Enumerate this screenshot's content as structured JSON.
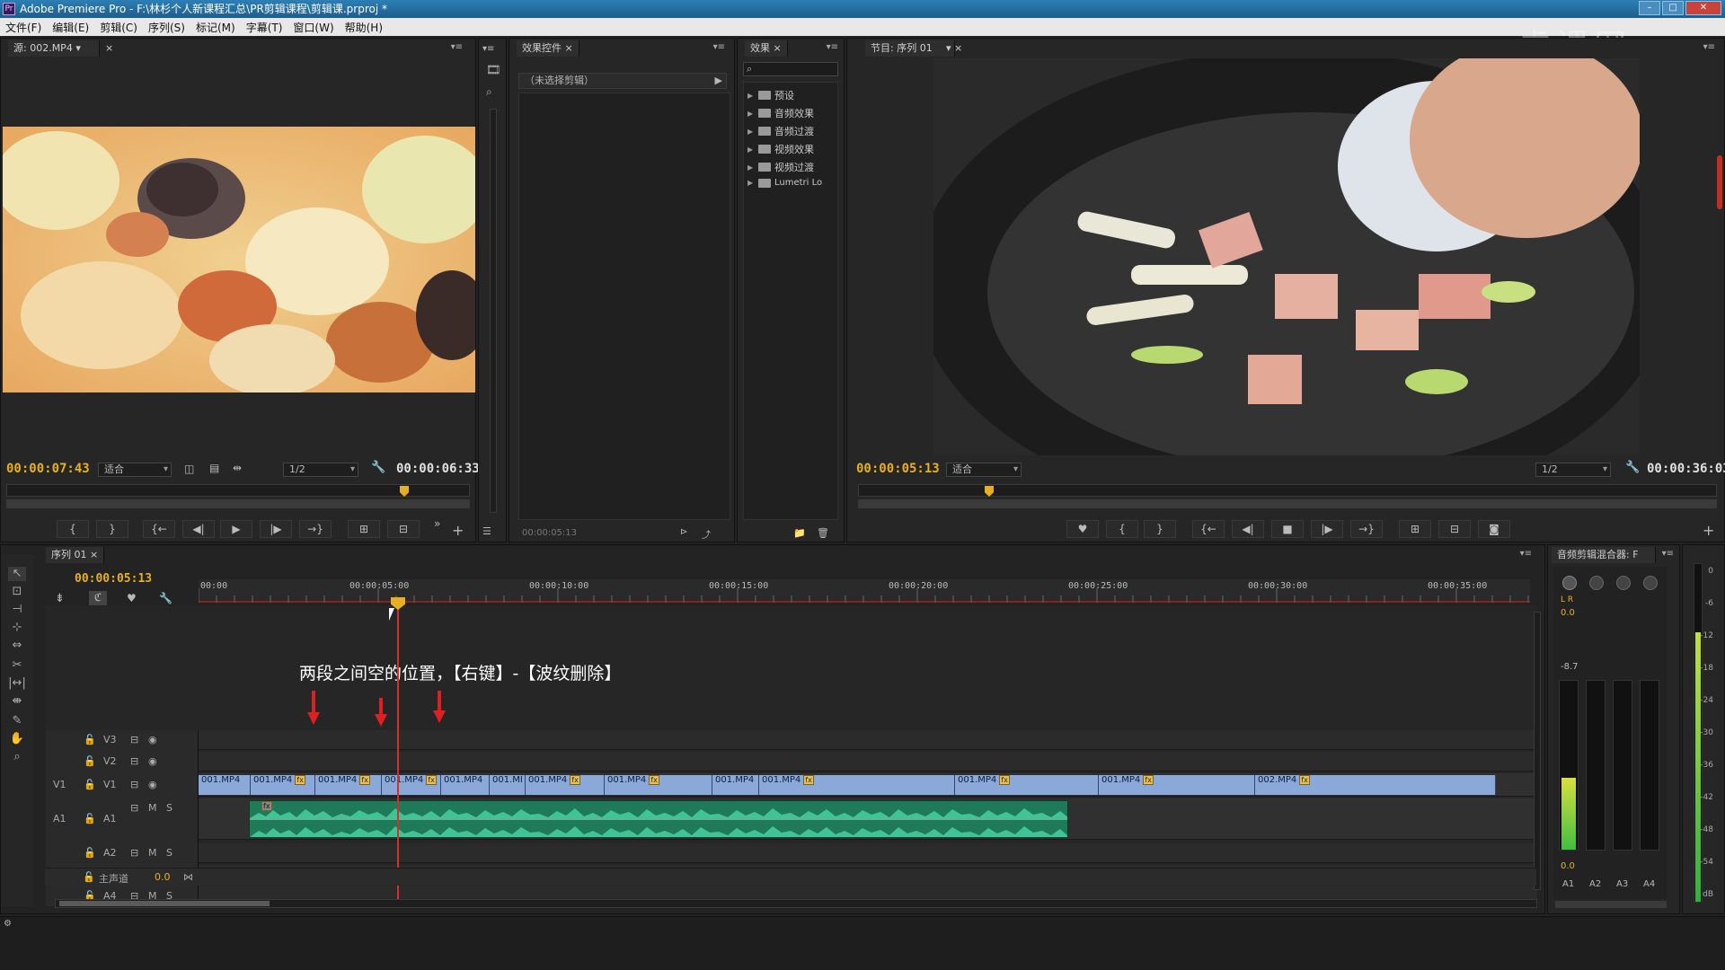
{
  "window": {
    "title": "Adobe Premiere Pro - F:\\林杉个人新课程汇总\\PR剪辑课程\\剪辑课.prproj *"
  },
  "menu": [
    "文件(F)",
    "编辑(E)",
    "剪辑(C)",
    "序列(S)",
    "标记(M)",
    "字幕(T)",
    "窗口(W)",
    "帮助(H)"
  ],
  "watermark": "虎课网",
  "source": {
    "tab": "源: 002.MP4",
    "timecode": "00:00:07:43",
    "fit": "适合",
    "res": "1/2",
    "duration": "00:00:06:33"
  },
  "effect_controls": {
    "tab": "效果控件",
    "no_clip": "（未选择剪辑）",
    "timecode": "00:00:05:13"
  },
  "effects": {
    "tab": "效果",
    "items": [
      "预设",
      "音频效果",
      "音频过渡",
      "视频效果",
      "视频过渡",
      "Lumetri Lo"
    ]
  },
  "program": {
    "tab": "节目: 序列 01",
    "timecode": "00:00:05:13",
    "fit": "适合",
    "res": "1/2",
    "duration": "00:00:36:03"
  },
  "timeline": {
    "tab": "序列 01",
    "timecode": "00:00:05:13",
    "ruler": [
      "00:00",
      "00:00:05:00",
      "00:00:10:00",
      "00:00:15:00",
      "00:00:20:00",
      "00:00:25:00",
      "00:00:30:00",
      "00:00:35:00"
    ],
    "annotation": "两段之间空的位置，【右键】-【波纹删除】",
    "tracks": {
      "v3": "V3",
      "v2": "V2",
      "v1": "V1",
      "v1src": "V1",
      "a1": "A1",
      "a1src": "A1",
      "a2": "A2",
      "a3": "A3",
      "a4": "A4",
      "master": "主声道",
      "master_val": "0.0"
    },
    "clips": [
      "001.MP4",
      "001.MP4",
      "001.MP4",
      "001.MP4",
      "001.MP4",
      "001.MI",
      "001.MP4",
      "001.MP4",
      "001.MP4",
      "001.MP4",
      "001.MP4",
      "001.MP4",
      "002.MP4"
    ]
  },
  "mixer": {
    "tab": "音频剪辑混合器: F",
    "channels": [
      "A1",
      "A2",
      "A3",
      "A4"
    ],
    "val": "0.0",
    "peak": "-8.7",
    "lr": "L R",
    "bottom_val": "0.0"
  },
  "meter": {
    "scale": [
      "0",
      "-6",
      "-12",
      "-18",
      "-24",
      "-30",
      "-36",
      "-42",
      "-48",
      "-54",
      "dB"
    ]
  },
  "colors": {
    "accent": "#e8b020",
    "playhead": "#d03030",
    "video_clip": "#8aa8d8",
    "audio_clip": "#1f7a5a",
    "waveform": "#3fc495"
  }
}
